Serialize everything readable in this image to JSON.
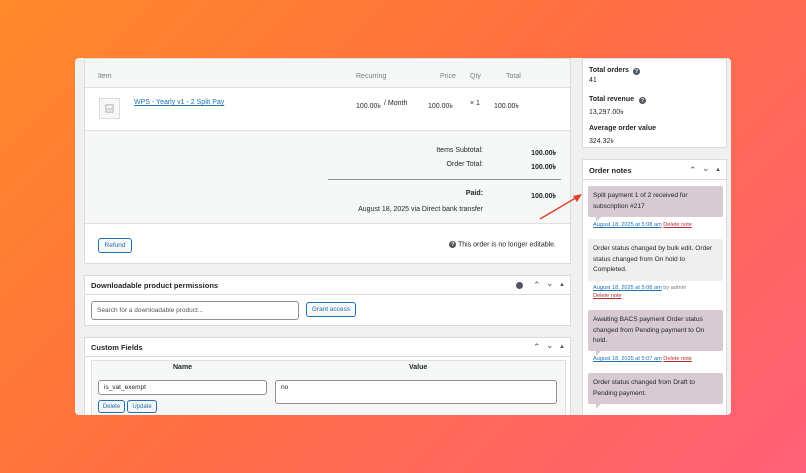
{
  "items_panel": {
    "headers": {
      "item": "Item",
      "recurring": "Recurring",
      "price": "Price",
      "qty": "Qty",
      "total": "Total"
    },
    "row": {
      "name": "WPS - Yearly v1 - 2 Split Pay",
      "recurring_amount": "100.00৳",
      "recurring_period": "/ Month",
      "price": "100.00৳",
      "qty": "× 1",
      "total": "100.00৳"
    },
    "totals": {
      "subtotal_label": "Items Subtotal:",
      "subtotal_value": "100.00৳",
      "order_total_label": "Order Total:",
      "order_total_value": "100.00৳",
      "paid_label": "Paid:",
      "paid_value": "100.00৳",
      "paid_note": "August 18, 2025 via Direct bank transfer"
    },
    "refund_label": "Refund",
    "not_editable": "This order is no longer editable."
  },
  "downloads_panel": {
    "title": "Downloadable product permissions",
    "search_placeholder": "Search for a downloadable product...",
    "grant_label": "Grant access"
  },
  "custom_fields": {
    "title": "Custom Fields",
    "col_name": "Name",
    "col_value": "Value",
    "field_name": "is_vat_exempt",
    "field_value": "no",
    "delete_label": "Delete",
    "update_label": "Update"
  },
  "stats": {
    "total_orders_label": "Total orders",
    "total_orders_value": "41",
    "total_revenue_label": "Total revenue",
    "total_revenue_value": "13,297.00৳",
    "avg_label": "Average order value",
    "avg_value": "324.32৳"
  },
  "order_notes": {
    "title": "Order notes",
    "notes": [
      {
        "text": "Split payment 1 of 2 received for subscription #217",
        "date": "August 18, 2025 at 5:08 am",
        "delete": "Delete note"
      },
      {
        "text": "Order status changed by bulk edit. Order status changed from On hold to Completed.",
        "date": "August 18, 2025 at 5:08 am",
        "by": "by admin",
        "delete": "Delete note"
      },
      {
        "text": "Awaiting BACS payment Order status changed from Pending payment to On hold.",
        "date": "August 18, 2025 at 5:07 am",
        "delete": "Delete note"
      },
      {
        "text": "Order status changed from Draft to Pending payment.",
        "date": "",
        "delete": ""
      }
    ]
  },
  "colors": {
    "accent": "#2271b1",
    "note_system": "#d7cad2",
    "arrow": "#e0402a"
  }
}
